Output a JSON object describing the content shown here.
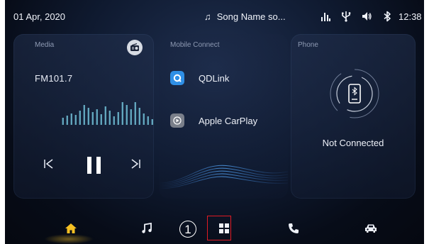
{
  "status_bar": {
    "date": "01 Apr, 2020",
    "song": "Song Name so...",
    "time": "12:38",
    "icons": [
      "signal-icon",
      "usb-icon",
      "volume-icon",
      "bluetooth-icon"
    ]
  },
  "media_card": {
    "title": "Media",
    "station": "FM101.7",
    "radio_icon": "radio-icon",
    "controls": [
      "previous-icon",
      "pause-icon",
      "next-icon"
    ]
  },
  "mobile_card": {
    "title": "Mobile Connect",
    "apps": [
      {
        "label": "QDLink",
        "icon": "qdlink-icon",
        "color": "#2f8fe6"
      },
      {
        "label": "Apple CarPlay",
        "icon": "carplay-icon",
        "color": "#7a7f8a"
      }
    ]
  },
  "phone_card": {
    "title": "Phone",
    "status": "Not Connected",
    "icon": "bluetooth-phone-icon"
  },
  "nav": {
    "items": [
      "home-icon",
      "music-icon",
      "apps-grid-icon",
      "phone-icon",
      "car-icon"
    ],
    "active_color": "#f5c023",
    "callout_number": "1",
    "highlight_color": "#e01b24"
  }
}
